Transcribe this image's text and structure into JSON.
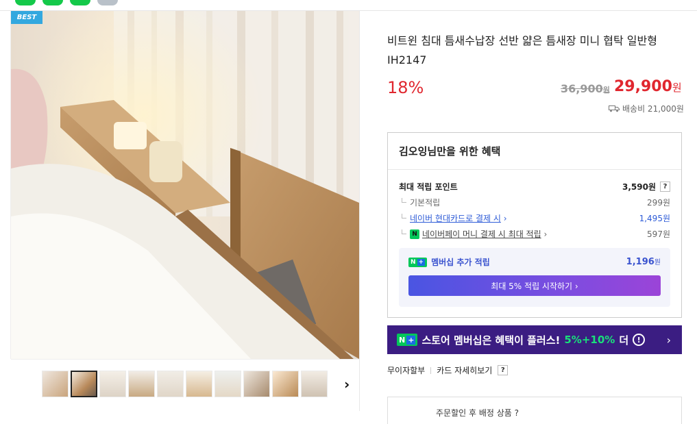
{
  "badge": "BEST",
  "product": {
    "title": "비트윈 침대 틈새수납장 선반 얇은 틈새장 미니 협탁 일반형 IH2147",
    "discount": "18%",
    "original_price": "36,900",
    "original_unit": "원",
    "price": "29,900",
    "price_unit": "원",
    "shipping": "배송비 21,000원"
  },
  "benefits": {
    "header": "김오잉님만을 위한 혜택",
    "max_points_label": "최대 적립 포인트",
    "max_points_value": "3,590원",
    "help": "?",
    "items": [
      {
        "label": "기본적립",
        "value": "299원"
      },
      {
        "label": "네이버 현대카드로 결제 시",
        "value": "1,495원"
      },
      {
        "label": "네이버페이 머니 결제 시 최대 적립",
        "value": "597원"
      }
    ],
    "membership": {
      "label": "멤버십 추가 적립",
      "value": "1,196",
      "unit": "원",
      "button": "최대 5% 적립 시작하기 ›"
    }
  },
  "banner": {
    "text_a": "스토어 멤버십은 혜택이 플러스!",
    "text_green": "5%+10%",
    "text_b": "더",
    "chevron": "›"
  },
  "card_info": {
    "interest_free": "무이자할부",
    "card_detail": "카드 자세히보기",
    "help": "?"
  },
  "bottom_partial": "주문할인 후 배정 상품 ?"
}
